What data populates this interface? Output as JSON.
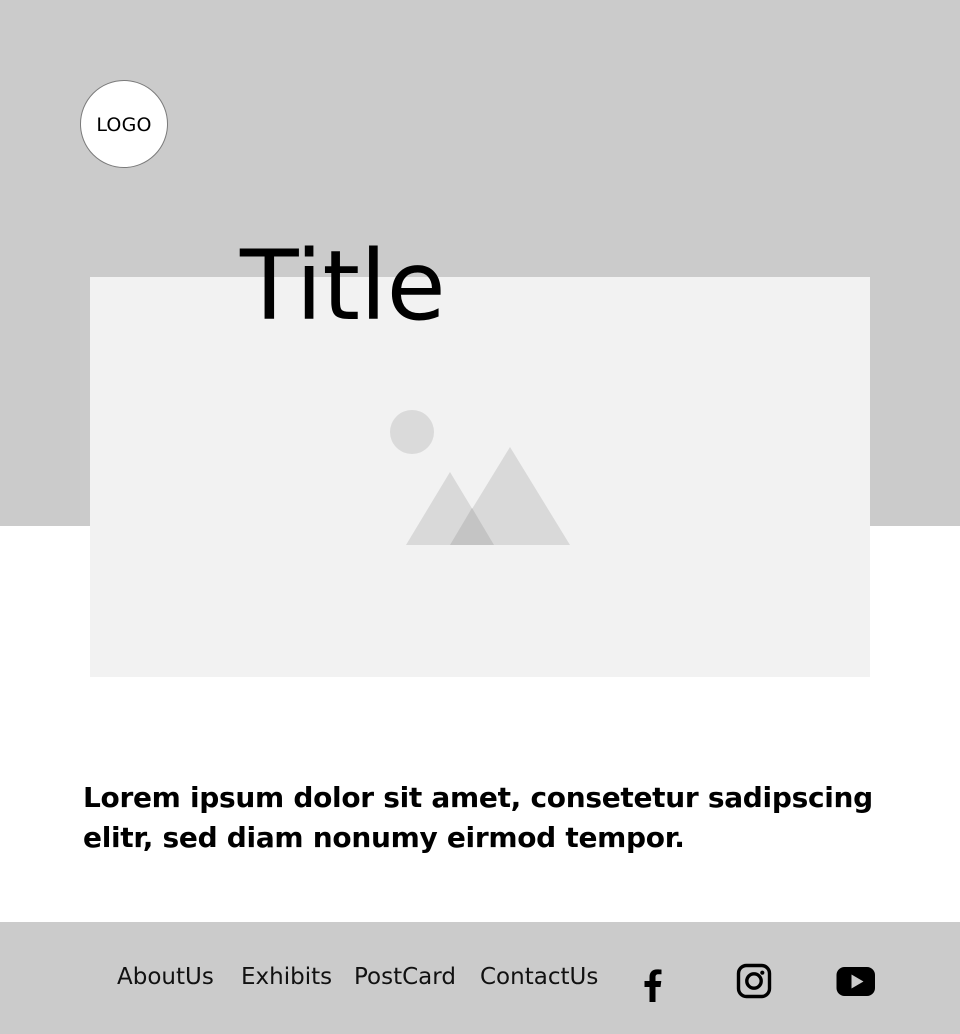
{
  "header": {
    "logo_text": "LOGO",
    "title": "Title"
  },
  "hero": {
    "image_icon": "image-placeholder-icon"
  },
  "content": {
    "lead_text": "Lorem ipsum dolor sit amet, consetetur sadipscing elitr, sed diam nonumy eirmod tempor."
  },
  "footer": {
    "links": [
      {
        "label": "AboutUs"
      },
      {
        "label": "Exhibits"
      },
      {
        "label": "PostCard"
      },
      {
        "label": "ContactUs"
      }
    ],
    "social": [
      {
        "icon": "facebook-icon"
      },
      {
        "icon": "instagram-icon"
      },
      {
        "icon": "youtube-icon"
      }
    ]
  },
  "colors": {
    "header_background": "#cbcbcb",
    "image_placeholder": "#f2f2f2",
    "footer_background": "#cbcbcb"
  }
}
